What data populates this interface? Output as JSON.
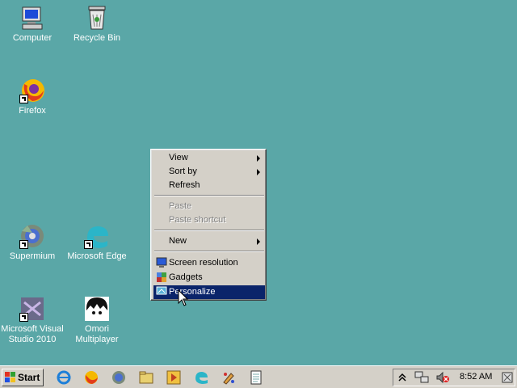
{
  "desktop": {
    "icons": [
      {
        "label": "Computer",
        "icon": "computer-icon"
      },
      {
        "label": "Recycle Bin",
        "icon": "recycle-bin-icon"
      },
      {
        "label": "Firefox",
        "icon": "firefox-icon"
      },
      {
        "label": "Supermium",
        "icon": "supermium-icon"
      },
      {
        "label": "Microsoft Edge",
        "icon": "edge-icon"
      },
      {
        "label_line1": "Microsoft Visual",
        "label_line2": "Studio 2010",
        "icon": "visual-studio-icon"
      },
      {
        "label_line1": "Omori",
        "label_line2": "Multiplayer",
        "icon": "omori-icon"
      }
    ]
  },
  "context_menu": {
    "items": [
      {
        "label": "View",
        "submenu": true
      },
      {
        "label": "Sort by",
        "submenu": true
      },
      {
        "label": "Refresh"
      },
      {
        "label": "Paste",
        "disabled": true
      },
      {
        "label": "Paste shortcut",
        "disabled": true
      },
      {
        "label": "New",
        "submenu": true
      },
      {
        "label": "Screen resolution",
        "icon": "display-icon"
      },
      {
        "label": "Gadgets",
        "icon": "gadgets-icon"
      },
      {
        "label": "Personalize",
        "icon": "personalize-icon",
        "selected": true
      }
    ]
  },
  "taskbar": {
    "start_label": "Start",
    "quick_launch": [
      "internet-explorer-icon",
      "firefox-icon",
      "supermium-icon",
      "folder-icon",
      "media-player-icon",
      "edge-icon",
      "paint-icon",
      "notepad-icon"
    ],
    "tray_icons": [
      "show-hidden-icons-chevron",
      "network-icon",
      "volume-muted-icon"
    ],
    "clock": "8:52 AM"
  },
  "colors": {
    "desktop_background": "#5aa7a7",
    "menu_highlight": "#0a246a",
    "face": "#d4d0c8"
  }
}
